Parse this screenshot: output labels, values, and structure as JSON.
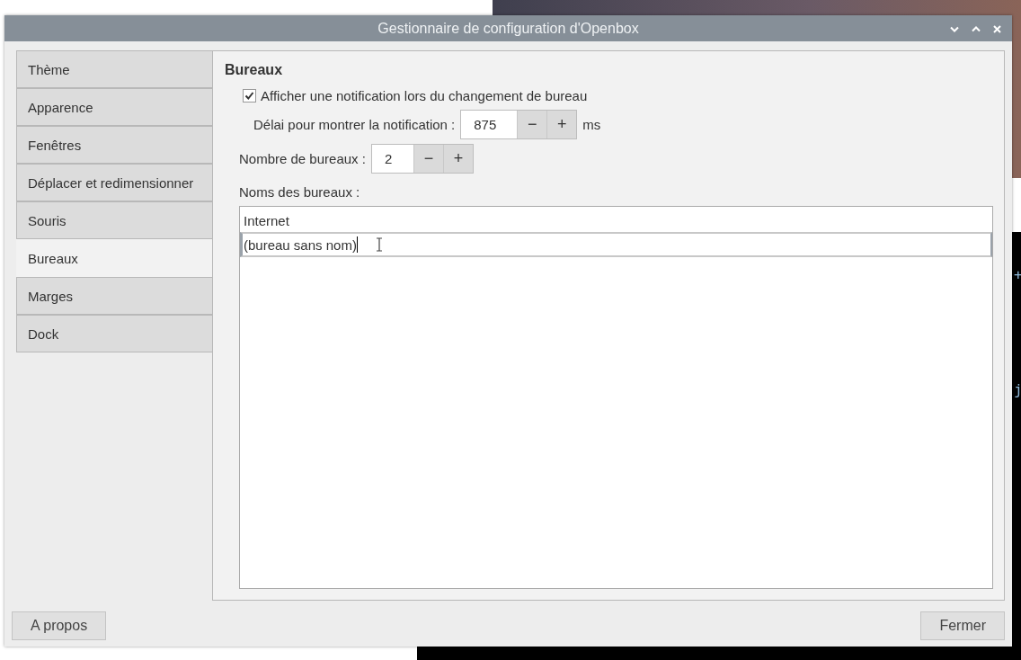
{
  "background": {
    "terminal_text": [
      "+",
      "j"
    ]
  },
  "window": {
    "title": "Gestionnaire de configuration d'Openbox",
    "controls": [
      {
        "kind": "minimize"
      },
      {
        "kind": "maximize"
      },
      {
        "kind": "close"
      }
    ]
  },
  "tabs": [
    {
      "label": "Thème",
      "selected": false
    },
    {
      "label": "Apparence",
      "selected": false
    },
    {
      "label": "Fenêtres",
      "selected": false
    },
    {
      "label": "Déplacer et redimensionner",
      "selected": false
    },
    {
      "label": "Souris",
      "selected": false
    },
    {
      "label": "Bureaux",
      "selected": true
    },
    {
      "label": "Marges",
      "selected": false
    },
    {
      "label": "Dock",
      "selected": false
    }
  ],
  "section_title": "Bureaux",
  "notify_checkbox": {
    "label": "Afficher une notification lors du changement de bureau",
    "checked": true
  },
  "delay": {
    "label": "Délai pour montrer la notification :",
    "value": "875",
    "minus": "−",
    "plus": "+",
    "unit": "ms"
  },
  "count": {
    "label": "Nombre de bureaux :",
    "value": "2",
    "minus": "−",
    "plus": "+"
  },
  "names_label": "Noms des bureaux :",
  "names": [
    {
      "text": "Internet",
      "editing": false
    },
    {
      "text": "(bureau sans nom)",
      "editing": true
    }
  ],
  "buttons": {
    "about": "A propos",
    "close": "Fermer"
  }
}
